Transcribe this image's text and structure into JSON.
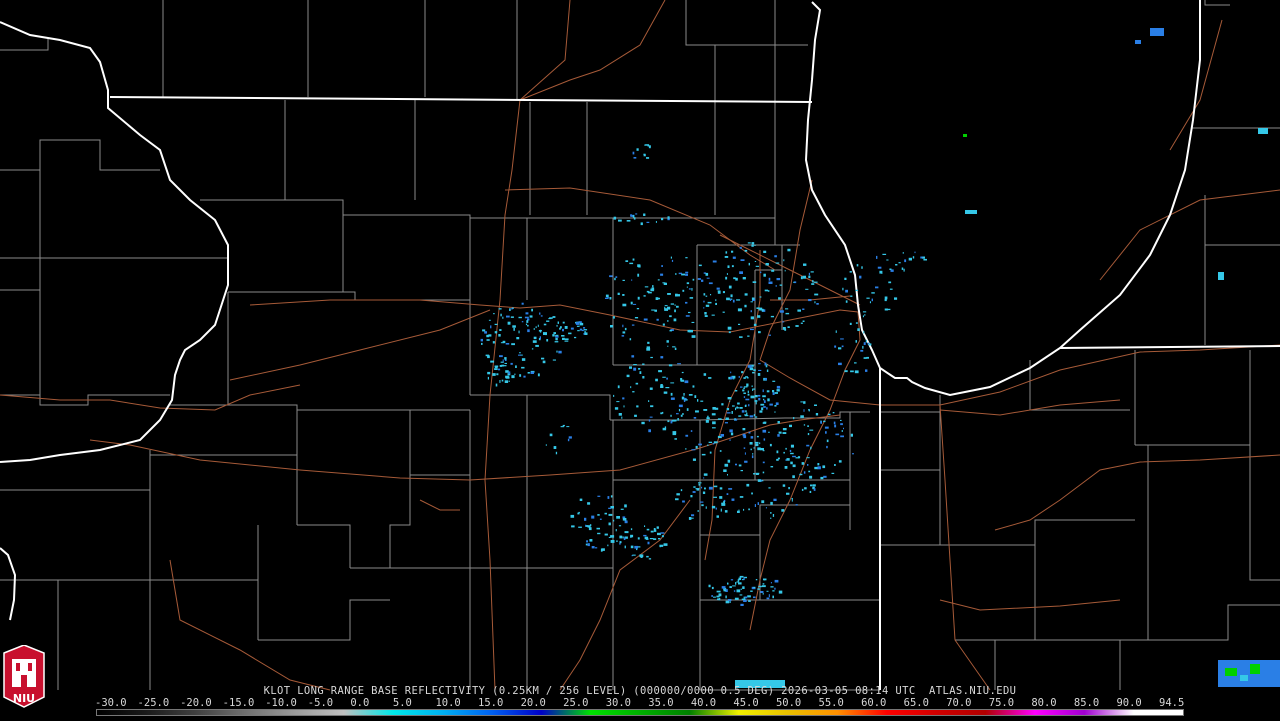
{
  "product": {
    "title": "KLOT LONG RANGE BASE REFLECTIVITY (0.25KM / 256 LEVEL) (000000/0000 0.5 DEG) 2026-03-05 08:14 UTC  ATLAS.NIU.EDU"
  },
  "logo": {
    "text": "NIU"
  },
  "colors": {
    "state_border": "#ffffff",
    "county_border": "#9a9a9a",
    "highway": "#b0623a",
    "echo_light": "#35c8e8",
    "echo_dark": "#2a7fe6"
  },
  "scale": {
    "labels": [
      "-30.0",
      "-25.0",
      "-20.0",
      "-15.0",
      "-10.0",
      "-5.0",
      "0.0",
      "5.0",
      "10.0",
      "15.0",
      "20.0",
      "25.0",
      "30.0",
      "35.0",
      "40.0",
      "45.0",
      "50.0",
      "55.0",
      "60.0",
      "65.0",
      "70.0",
      "75.0",
      "80.0",
      "85.0",
      "90.0",
      "94.5"
    ],
    "stops": [
      "#000000",
      "#1a1a1a",
      "#404040",
      "#707070",
      "#9a9a9a",
      "#c0c0c0",
      "#00e8e8",
      "#00b0f0",
      "#0060f0",
      "#0000c8",
      "#00e000",
      "#00b000",
      "#008000",
      "#f0f000",
      "#e8c000",
      "#ff9000",
      "#ff0000",
      "#d00000",
      "#b00000",
      "#ff00ff",
      "#a000d0",
      "#ffffff",
      "#ffffff"
    ]
  }
}
